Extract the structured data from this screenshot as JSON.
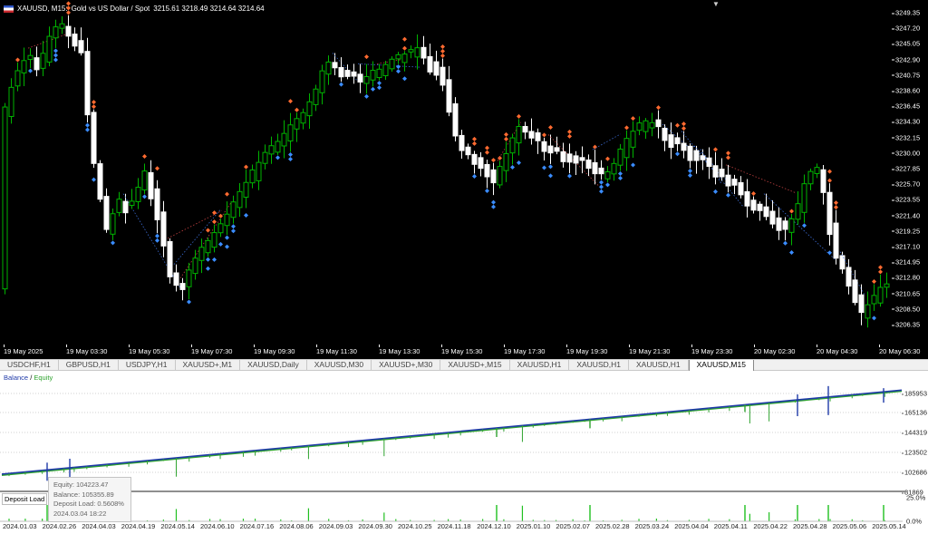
{
  "chart": {
    "flag_icon": "us-flag-icon",
    "header_symbol": "XAUUSD, M15:",
    "header_desc": "Gold vs US Dollar / Spot",
    "header_prices": "3215.61 3218.49 3214.64 3214.64",
    "price_ticks": [
      "3249.35",
      "3247.20",
      "3245.05",
      "3242.90",
      "3240.75",
      "3238.60",
      "3236.45",
      "3234.30",
      "3232.15",
      "3230.00",
      "3227.85",
      "3225.70",
      "3223.55",
      "3221.40",
      "3219.25",
      "3217.10",
      "3214.95",
      "3212.80",
      "3210.65",
      "3208.50",
      "3206.35"
    ],
    "time_ticks": [
      "19 May 2025",
      "19 May 03:30",
      "19 May 05:30",
      "19 May 07:30",
      "19 May 09:30",
      "19 May 11:30",
      "19 May 13:30",
      "19 May 15:30",
      "19 May 17:30",
      "19 May 19:30",
      "19 May 21:30",
      "19 May 23:30",
      "20 May 02:30",
      "20 May 04:30",
      "20 May 06:30"
    ],
    "colors": {
      "bull": "#00b400",
      "bear": "#ffffff",
      "sell_marker": "#ff6a30",
      "buy_marker": "#3a8cff"
    }
  },
  "tabs": [
    {
      "label": "USDCHF,H1"
    },
    {
      "label": "GBPUSD,H1"
    },
    {
      "label": "USDJPY,H1"
    },
    {
      "label": "XAUUSD+,M1"
    },
    {
      "label": "XAUUSD,Daily"
    },
    {
      "label": "XAUUSD,M30"
    },
    {
      "label": "XAUUSD+,M30"
    },
    {
      "label": "XAUUSD+,M15"
    },
    {
      "label": "XAUUSD,H1"
    },
    {
      "label": "XAUUSD,H1"
    },
    {
      "label": "XAUUSD,H1"
    },
    {
      "label": "XAUUSD,M15",
      "active": true
    }
  ],
  "balance": {
    "legend_balance": "Balance",
    "legend_sep": " / ",
    "legend_equity": "Equity",
    "ticks": [
      "185953",
      "165136",
      "144319",
      "123502",
      "102686",
      "81869"
    ],
    "start_value": 101000,
    "end_value": 189500,
    "deposit_label": "Deposit Load",
    "deposit_ticks": [
      "25.0%",
      "0.0%"
    ],
    "tooltip": {
      "equity": "Equity: 104223.47",
      "balance": "Balance: 105355.89",
      "deposit_load": "Deposit Load: 0.5608%",
      "time": "2024.03.04 18:22"
    },
    "dates": [
      "2024.01.03",
      "2024.02.26",
      "2024.04.03",
      "2024.04.19",
      "2024.05.14",
      "2024.06.10",
      "2024.07.16",
      "2024.08.06",
      "2024.09.03",
      "2024.09.30",
      "2024.10.25",
      "2024.11.18",
      "2024.12.10",
      "2025.01.10",
      "2025.02.07",
      "2025.02.28",
      "2025.03.24",
      "2025.04.04",
      "2025.04.11",
      "2025.04.22",
      "2025.04.28",
      "2025.05.06",
      "2025.05.14"
    ],
    "colors": {
      "balance": "#1f3aa8",
      "equity": "#2fa32f",
      "deposit": "#20c020"
    }
  }
}
